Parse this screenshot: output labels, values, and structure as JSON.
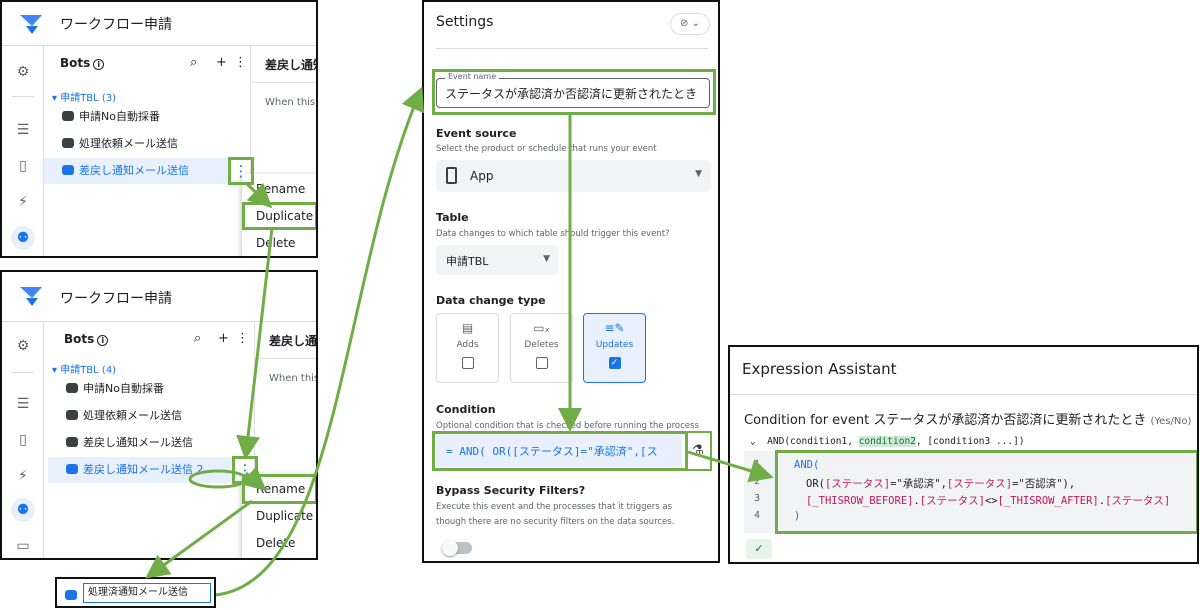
{
  "app": {
    "title": "ワークフロー申請",
    "bots_label": "Bots",
    "right_heading": "差戻し通知",
    "right_heading2": "差戻し通",
    "when_text": "When this",
    "group_label_1": "申請TBL (3)",
    "group_label_2": "申請TBL (4)",
    "bots_1": [
      "申請No自動採番",
      "処理依頼メール送信",
      "差戻し通知メール送信"
    ],
    "bots_2": [
      "申請No自動採番",
      "処理依頼メール送信",
      "差戻し通知メール送信",
      "差戻し通知メール送信 2"
    ],
    "menu": [
      "Rename",
      "Duplicate",
      "Delete"
    ],
    "rename_value": "処理済通知メール送信"
  },
  "settings": {
    "title": "Settings",
    "event_name_label": "Event name",
    "event_name": "ステータスが承認済か否認済に更新されたとき",
    "event_source_label": "Event source",
    "event_source_desc": "Select the product or schedule that runs your event",
    "event_source_value": "App",
    "table_label": "Table",
    "table_desc": "Data changes to which table should trigger this event?",
    "table_value": "申請TBL",
    "change_type_label": "Data change type",
    "change_types": [
      {
        "label": "Adds",
        "checked": false
      },
      {
        "label": "Deletes",
        "checked": false
      },
      {
        "label": "Updates",
        "checked": true
      }
    ],
    "condition_label": "Condition",
    "condition_desc": "Optional condition that is checked before running the process",
    "condition_value": "=  AND( OR([ステータス]=\"承認済\",[ス",
    "bypass_label": "Bypass Security Filters?",
    "bypass_desc_1": "Execute this event and the processes that it triggers as",
    "bypass_desc_2": "though there are no security filters on the data sources."
  },
  "assistant": {
    "title": "Expression Assistant",
    "subtitle": "Condition for event ステータスが承認済か否認済に更新されたとき",
    "type_hint": "(Yes/No)",
    "signature_pre": "AND(condition1, ",
    "signature_hl": "condition2",
    "signature_post": ", [condition3 ...])",
    "line_numbers": [
      "1",
      "2",
      "3",
      "4"
    ],
    "code": {
      "l1": "AND(",
      "l2a": "OR(",
      "l2b": "[ステータス]",
      "l2c": "=\"承認済\",",
      "l2d": "[ステータス]",
      "l2e": "=\"否認済\"),",
      "l3a": "[_THISROW_BEFORE]",
      "l3b": ".",
      "l3c": "[ステータス]",
      "l3d": "<>",
      "l3e": "[_THISROW_AFTER]",
      "l3f": ".",
      "l3g": "[ステータス]",
      "l4": ")"
    }
  },
  "colors": {
    "accent": "#1a73e8",
    "highlight_green": "#70ad47",
    "code_column": "#c2185b"
  }
}
